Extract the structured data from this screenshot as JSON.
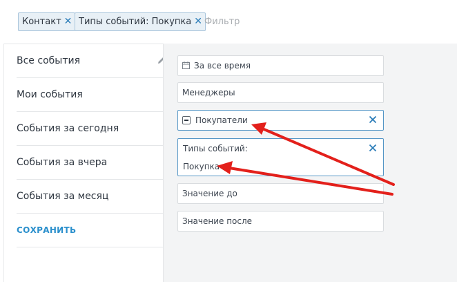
{
  "filter_bar": {
    "chips": [
      {
        "label": "Контакт"
      },
      {
        "label": "Типы событий: Покупка"
      }
    ],
    "close_glyph": "✕",
    "placeholder": "Фильтр"
  },
  "menu": {
    "items": [
      {
        "label": "Все события"
      },
      {
        "label": "Мои события"
      },
      {
        "label": "События за сегодня"
      },
      {
        "label": "События за вчера"
      },
      {
        "label": "События за месяц"
      }
    ],
    "save_label": "СОХРАНИТЬ"
  },
  "panel": {
    "date_field": {
      "value": "За все время",
      "icon": "calendar-icon"
    },
    "managers_field": {
      "value": "Менеджеры"
    },
    "buyers_field": {
      "value": "Покупатели",
      "icon": "minus-checkbox-icon"
    },
    "types_field": {
      "label": "Типы событий:",
      "value": "Покупка"
    },
    "value_to_field": {
      "placeholder": "Значение до"
    },
    "value_after_field": {
      "placeholder": "Значение после"
    }
  },
  "colors": {
    "accent": "#2a8fcc",
    "arrow": "#e3201b",
    "panel_bg": "#f3f4f5"
  }
}
